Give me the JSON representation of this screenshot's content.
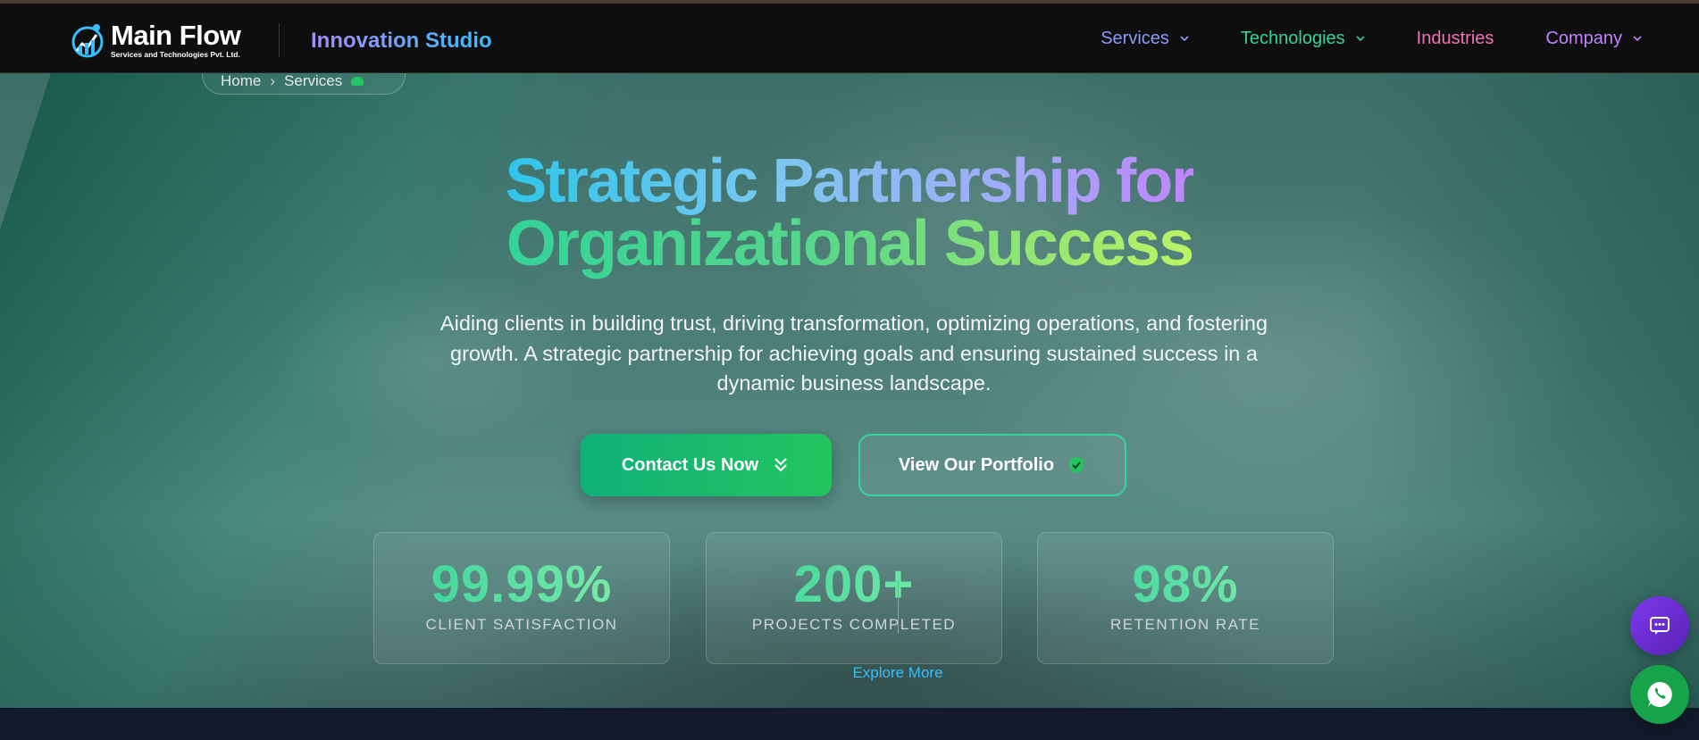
{
  "brand": {
    "name": "Main Flow",
    "subtitle": "Services and Technologies Pvt. Ltd.",
    "studio": "Innovation Studio"
  },
  "nav": {
    "items": [
      {
        "label": "Services",
        "has_dropdown": true,
        "color": "#8b9cf6"
      },
      {
        "label": "Technologies",
        "has_dropdown": true,
        "color": "#34d399"
      },
      {
        "label": "Industries",
        "has_dropdown": false,
        "color": "#f472b6"
      },
      {
        "label": "Company",
        "has_dropdown": true,
        "color": "#c084fc"
      }
    ]
  },
  "breadcrumb": {
    "home": "Home",
    "separator": "›",
    "current": "Services"
  },
  "hero": {
    "headline_line1": "Strategic Partnership for",
    "headline_line2": "Organizational Success",
    "description": "Aiding clients in building trust, driving transformation, optimizing operations, and fostering growth. A strategic partnership for achieving goals and ensuring sustained success in a dynamic business landscape.",
    "primary_cta": "Contact Us Now",
    "secondary_cta": "View Our Portfolio",
    "explore": "Explore More"
  },
  "stats": [
    {
      "value": "99.99%",
      "label": "CLIENT SATISFACTION"
    },
    {
      "value": "200+",
      "label": "PROJECTS COMPLETED"
    },
    {
      "value": "98%",
      "label": "RETENTION RATE"
    }
  ],
  "colors": {
    "accent_green": "#22c55e",
    "accent_cyan": "#38bdf8",
    "accent_purple": "#7c3aed",
    "nav_bg": "#0e0e0f"
  },
  "icons": {
    "primary_cta": "double-chevron-down-icon",
    "secondary_cta": "shield-check-icon",
    "chat_fab": "chat-bubble-icon",
    "whatsapp_fab": "whatsapp-icon"
  }
}
